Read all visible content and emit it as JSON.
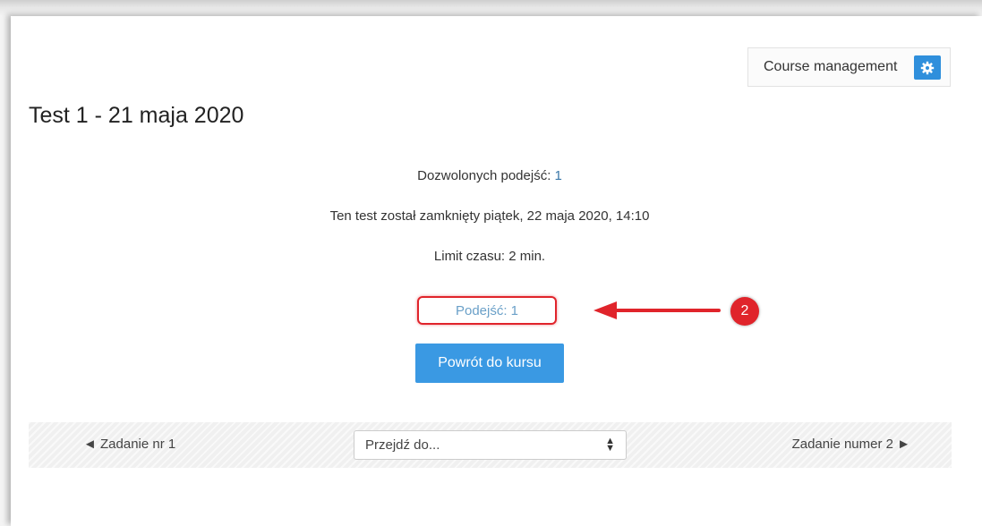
{
  "header": {
    "course_management_label": "Course management",
    "gear_icon": "gear-icon"
  },
  "quiz": {
    "title": "Test 1 - 21 maja 2020",
    "attempts_allowed_label": "Dozwolonych podejść: ",
    "attempts_allowed_value": "1",
    "closed_text": "Ten test został zamknięty piątek, 22 maja 2020, 14:10",
    "time_limit_text": "Limit czasu: 2 min.",
    "attempt_link": "Podejść: 1",
    "back_button": "Powrót do kursu"
  },
  "annotation": {
    "badge_number": "2",
    "highlight_color": "#e0242b"
  },
  "navigation": {
    "prev_label": "◄ Zadanie nr 1",
    "jump_select_value": "Przejdź do...",
    "next_label": "Zadanie numer 2 ►"
  },
  "colors": {
    "accent": "#3a99e3",
    "link": "#6aa0c8",
    "annotation_red": "#e0242b"
  }
}
